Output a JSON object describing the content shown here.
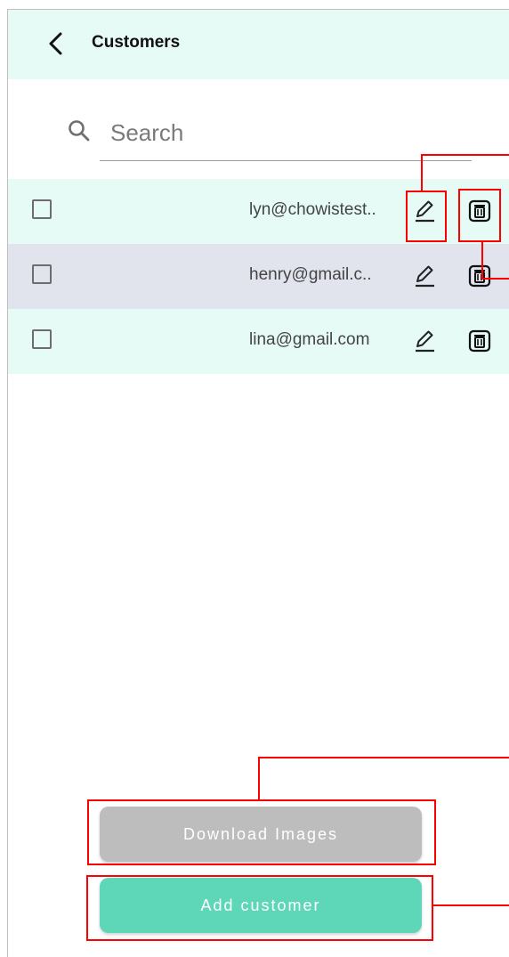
{
  "appbar": {
    "title": "Customers",
    "back_icon": "chevron-left-icon"
  },
  "search": {
    "placeholder": "Search",
    "value": "",
    "icon": "search-icon"
  },
  "customers": [
    {
      "email": "lyn@chowistest..",
      "checked": false
    },
    {
      "email": "henry@gmail.c..",
      "checked": false
    },
    {
      "email": "lina@gmail.com",
      "checked": false
    }
  ],
  "row_actions": {
    "edit_icon": "pencil-icon",
    "delete_icon": "trash-icon"
  },
  "buttons": {
    "download_images": "Download Images",
    "add_customer": "Add customer"
  },
  "colors": {
    "header_bg": "#e6faf6",
    "row_alt_bg": "#e1e4ec",
    "primary": "#5ed6b8",
    "disabled": "#bdbdbd",
    "annotation": "#ff0000"
  }
}
